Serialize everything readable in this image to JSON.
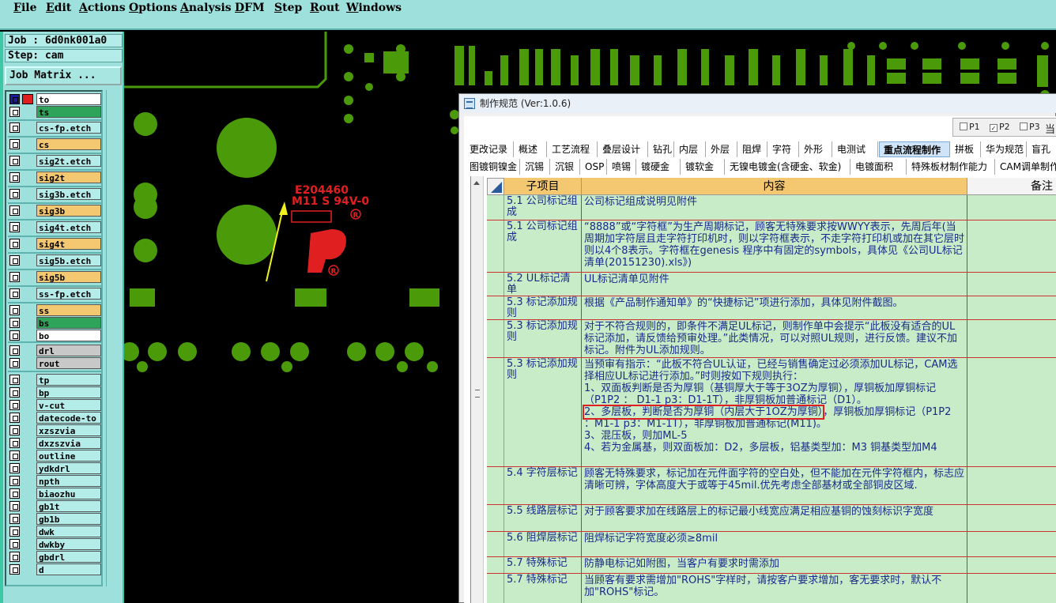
{
  "menubar": {
    "items": [
      "File",
      "Edit",
      "Actions",
      "Options",
      "Analysis",
      "DFM",
      "Step",
      "Rout",
      "Windows"
    ]
  },
  "left_panel": {
    "job": "Job : 6d0nk001a0",
    "step": "Step: cam",
    "job_matrix_button": "Job Matrix ...",
    "layers": [
      {
        "name": "to",
        "color": "#ffffff"
      },
      {
        "name": "ts",
        "color": "#2ea45a"
      },
      {
        "name": "cs-fp.etch",
        "color": "#b4ecea"
      },
      {
        "name": "cs",
        "color": "#f4c870"
      },
      {
        "name": "sig2t.etch",
        "color": "#b4ecea"
      },
      {
        "name": "sig2t",
        "color": "#f4c870"
      },
      {
        "name": "sig3b.etch",
        "color": "#b4ecea"
      },
      {
        "name": "sig3b",
        "color": "#f4c870"
      },
      {
        "name": "sig4t.etch",
        "color": "#b4ecea"
      },
      {
        "name": "sig4t",
        "color": "#f4c870"
      },
      {
        "name": "sig5b.etch",
        "color": "#b4ecea"
      },
      {
        "name": "sig5b",
        "color": "#f4c870"
      },
      {
        "name": "ss-fp.etch",
        "color": "#b4ecea"
      },
      {
        "name": "ss",
        "color": "#f4c870"
      },
      {
        "name": "bs",
        "color": "#2ea45a"
      },
      {
        "name": "bo",
        "color": "#ffffff"
      },
      {
        "name": "drl",
        "color": "#c8c8c8"
      },
      {
        "name": "rout",
        "color": "#c8c8c8"
      },
      {
        "name": "tp",
        "color": "#b4ecea"
      },
      {
        "name": "bp",
        "color": "#b4ecea"
      },
      {
        "name": "v-cut",
        "color": "#b4ecea"
      },
      {
        "name": "datecode-to",
        "color": "#b4ecea"
      },
      {
        "name": "xzszvia",
        "color": "#b4ecea"
      },
      {
        "name": "dxzszvia",
        "color": "#b4ecea"
      },
      {
        "name": "outline",
        "color": "#b4ecea"
      },
      {
        "name": "ydkdrl",
        "color": "#b4ecea"
      },
      {
        "name": "npth",
        "color": "#b4ecea"
      },
      {
        "name": "biaozhu",
        "color": "#b4ecea"
      },
      {
        "name": "gb1t",
        "color": "#b4ecea"
      },
      {
        "name": "gb1b",
        "color": "#b4ecea"
      },
      {
        "name": "dwk",
        "color": "#b4ecea"
      },
      {
        "name": "dwkby",
        "color": "#b4ecea"
      },
      {
        "name": "gbdrl",
        "color": "#b4ecea"
      },
      {
        "name": "d",
        "color": "#b4ecea"
      }
    ]
  },
  "canvas": {
    "marking_line1": "E204460",
    "marking_line2": "M11 S 94V-0",
    "colors": {
      "copper": "#4a9a0a",
      "background": "#000000",
      "marking": "#e02020",
      "arrow": "#f0f020"
    }
  },
  "dialog": {
    "title": "制作规范 (Ver:1.0.6)",
    "pages": [
      {
        "label": "P1",
        "checked": false
      },
      {
        "label": "P2",
        "checked": true
      },
      {
        "label": "P3",
        "checked": false
      }
    ],
    "pages_trailing": "当",
    "tabs_row1": [
      "更改记录",
      "概述",
      "工艺流程",
      "叠层设计",
      "钻孔",
      "内层",
      "外层",
      "阻焊",
      "字符",
      "外形",
      "电测试",
      "重点流程制作",
      "拼板",
      "华为规范",
      "盲孔"
    ],
    "active_tab": "重点流程制作",
    "tabs_row2": [
      "图镀铜镍金",
      "沉锡",
      "沉银",
      "OSP",
      "喷锡",
      "镀硬金",
      "镀软金",
      "无镍电镀金(含硬金、软金)",
      "电镀面积",
      "特殊板材制作能力",
      "CAM调单制作"
    ],
    "columns": [
      "子项目",
      "内容",
      "备注"
    ],
    "rows": [
      {
        "item": "5.1 公司标记组成",
        "content": "公司标记组成说明见附件"
      },
      {
        "item": "5.1 公司标记组成",
        "content": "“8888”或“字符框”为生产周期标记，顾客无特殊要求按WWYY表示，先周后年(当周期加字符层且走字符打印机时，则以字符框表示，不走字符打印机或加在其它层时则以4个8表示。字符框在genesis 程序中有固定的symbols，具体见《公司UL标记清单(20151230).xls》)"
      },
      {
        "item": "5.2 UL标记清单",
        "content": "UL标记清单见附件"
      },
      {
        "item": "5.3 标记添加规则",
        "content": "根据《产品制作通知单》的“快捷标记”项进行添加，具体见附件截图。"
      },
      {
        "item": "5.3 标记添加规则",
        "content": "对于不符合规则的，即条件不满足UL标记，则制作单中会提示“此板没有适合的UL标记添加，请反馈给预审处理。”此类情况，可以对照UL规则，进行反馈。建议不加标记。附件为UL添加规则。"
      },
      {
        "item": "5.3 标记添加规则",
        "content_lines": [
          "当预审有指示：“此板不符合UL认证，已经与销售确定过必须添加UL标记，CAM选择相应UL标记进行添加。”时则按如下规则执行：",
          "1、双面板判断是否为厚铜（基铜厚大于等于3OZ为厚铜），厚铜板加厚铜标记（P1P2 ： D1-1  p3：D1-1T），非厚铜板加普通标记（D1）。",
          "2、多层板，判断是否为厚铜（内层大于1OZ为厚铜）",
          "，厚铜板加厚铜标记（P1P2 ：M1-1    p3：M1-1T），非厚铜板加普通标记(M11)。",
          "3、混压板，则加ML-5",
          "4、若为金属基，则双面板加：D2，多层板，铝基类型加：M3   铜基类型加M4"
        ]
      },
      {
        "item": "5.4 字符层标记",
        "content": "顾客无特殊要求，标记加在元件面字符的空白处，但不能加在元件字符框内，标志应清晰可辨，字体高度大于或等于45mil.优先考虑全部基材或全部铜皮区域."
      },
      {
        "item": "5.5 线路层标记",
        "content": "对于顾客要求加在线路层上的标记最小线宽应满足相应基铜的蚀刻标识字宽度"
      },
      {
        "item": "5.6 阻焊层标记",
        "content": "阻焊标记字符宽度必须≥8mil"
      },
      {
        "item": "5.7 特殊标记",
        "content": "防静电标记如附图，当客户有要求时需添加"
      },
      {
        "item": "5.7 特殊标记",
        "content": "当顾客有要求需增加\"ROHS\"字样时，请按客户要求增加，客无要求时，默认不加\"ROHS\"标记。"
      }
    ]
  }
}
